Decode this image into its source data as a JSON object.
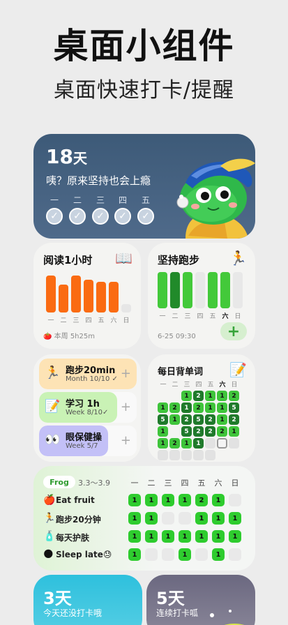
{
  "hero": {
    "title": "桌面小组件",
    "subtitle": "桌面快速打卡/提醒"
  },
  "streak": {
    "days_num": "18",
    "days_unit": "天",
    "message": "咦？原来坚持也会上瘾",
    "weekdays": [
      "一",
      "二",
      "三",
      "四",
      "五"
    ],
    "checks": [
      true,
      true,
      true,
      true,
      true
    ]
  },
  "reading": {
    "title": "阅读1小时",
    "icon": "book-icon",
    "icon_glyph": "📖",
    "bar_color": "#fa6b12",
    "day_labels": [
      "一",
      "二",
      "三",
      "四",
      "五",
      "六",
      "日"
    ],
    "values": [
      0.95,
      0.72,
      0.95,
      0.84,
      0.79,
      0.79,
      0.22
    ],
    "done": [
      true,
      true,
      true,
      true,
      true,
      true,
      false
    ],
    "footer_icon": "🍅",
    "footer": "本周 5h25m"
  },
  "running": {
    "title": "坚持跑步",
    "icon": "runner-icon",
    "icon_glyph": "🏃",
    "day_labels": [
      "一",
      "二",
      "三",
      "四",
      "五",
      "六",
      "日"
    ],
    "states": [
      "light",
      "dark",
      "light",
      "empty",
      "light",
      "light",
      "empty"
    ],
    "footer": "6-25 09:30",
    "add_label": "+"
  },
  "tasks": [
    {
      "icon_glyph": "🏃",
      "name": "跑步20min",
      "sub": "Month 10/10 ✓",
      "progress": 1.0,
      "color": "#fde3b5"
    },
    {
      "icon_glyph": "📝",
      "name": "学习 1h",
      "sub": "Week 8/10✓",
      "progress": 0.8,
      "color": "#c9f2b5"
    },
    {
      "icon_glyph": "👀",
      "name": "眼保健操",
      "sub": "Week 5/7",
      "progress": 0.71,
      "color": "#c3c0f7"
    }
  ],
  "task_add": "+",
  "vocab": {
    "title": "每日背单词",
    "icon": "memo-icon",
    "icon_glyph": "📝",
    "day_labels": [
      "一",
      "二",
      "三",
      "四",
      "五",
      "六",
      "日"
    ],
    "grid": [
      [
        null,
        null,
        "1",
        "2",
        "1",
        "1",
        "2"
      ],
      [
        "1",
        "2",
        "1",
        "2",
        "1",
        "1",
        "5"
      ],
      [
        "5",
        "1",
        "2",
        "5",
        "2",
        "1",
        "2"
      ],
      [
        "1",
        null,
        "5",
        "2",
        "2",
        "2",
        "1"
      ],
      [
        "1",
        "2",
        "1",
        "1",
        "",
        null,
        ""
      ],
      [
        "",
        "",
        "",
        "",
        "",
        null,
        null
      ]
    ],
    "shades": [
      [
        "n",
        "n",
        "g",
        "d",
        "g",
        "g",
        "g"
      ],
      [
        "g",
        "g",
        "d",
        "g",
        "g",
        "g",
        "d"
      ],
      [
        "d",
        "g",
        "d",
        "d",
        "d",
        "g",
        "d"
      ],
      [
        "g",
        "n",
        "d",
        "d",
        "d",
        "g",
        "g"
      ],
      [
        "g",
        "g",
        "g",
        "d",
        "e",
        "o",
        "e"
      ],
      [
        "e",
        "e",
        "e",
        "e",
        "e",
        "n",
        "n"
      ]
    ]
  },
  "habit": {
    "tag": "Frog",
    "range": "3.3～3.9",
    "day_labels": [
      "一",
      "二",
      "三",
      "四",
      "五",
      "六",
      "日"
    ],
    "rows": [
      {
        "icon_glyph": "🍎",
        "name": "Eat fruit",
        "cells": [
          "1",
          "1",
          "1",
          "1",
          "2",
          "1",
          ""
        ]
      },
      {
        "icon_glyph": "🏃",
        "name": "跑步20分钟",
        "cells": [
          "1",
          "1",
          "",
          "",
          "1",
          "1",
          "1"
        ]
      },
      {
        "icon_glyph": "🧴",
        "name": "每天护肤",
        "cells": [
          "1",
          "1",
          "1",
          "1",
          "1",
          "1",
          "1"
        ]
      },
      {
        "icon_glyph": "🌑",
        "name": "Sleep late😓",
        "cells": [
          "1",
          "",
          "",
          "1",
          "",
          "1",
          ""
        ]
      }
    ]
  },
  "bottom_cards": [
    {
      "days": "3天",
      "msg": "今天还没打卡哦"
    },
    {
      "days": "5天",
      "msg": "连续打卡呱"
    }
  ]
}
